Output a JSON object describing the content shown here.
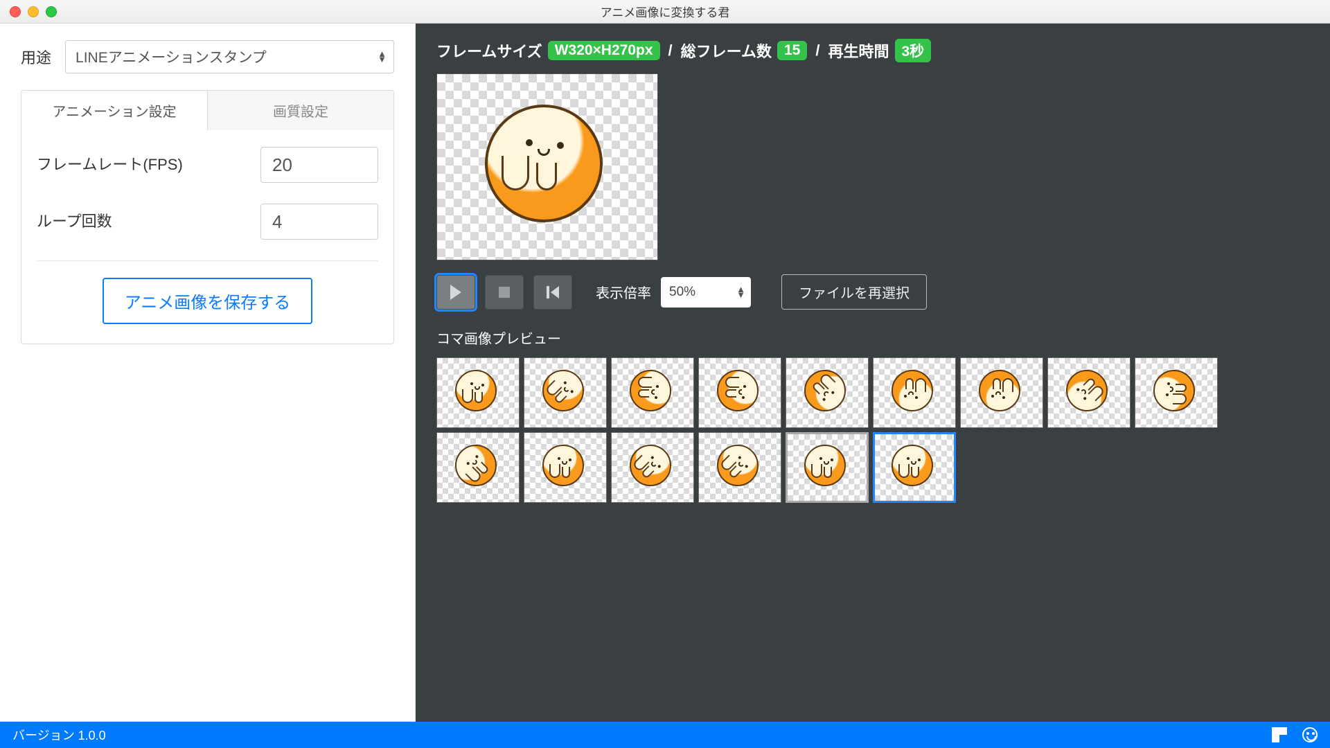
{
  "title": "アニメ画像に変換する君",
  "sidebar": {
    "purpose_label": "用途",
    "purpose_value": "LINEアニメーションスタンプ",
    "tabs": {
      "anim": "アニメーション設定",
      "quality": "画質設定"
    },
    "framerate_label": "フレームレート(FPS)",
    "framerate_value": "20",
    "loop_label": "ループ回数",
    "loop_value": "4",
    "save_btn": "アニメ画像を保存する"
  },
  "content": {
    "frame_size_label": "フレームサイズ",
    "frame_size_value": "W320×H270px",
    "total_frames_label": "総フレーム数",
    "total_frames_value": "15",
    "duration_label": "再生時間",
    "duration_value": "3秒",
    "zoom_label": "表示倍率",
    "zoom_value": "50%",
    "reselect_btn": "ファイルを再選択",
    "frames_title": "コマ画像プレビュー"
  },
  "footer": {
    "version": "バージョン 1.0.0"
  },
  "frames": [
    {
      "rot": "rot0"
    },
    {
      "rot": "rot45"
    },
    {
      "rot": "rot90"
    },
    {
      "rot": "rot90"
    },
    {
      "rot": "rot135"
    },
    {
      "rot": "rot180"
    },
    {
      "rot": "rot180"
    },
    {
      "rot": "rot225"
    },
    {
      "rot": "rot270"
    },
    {
      "rot": "rot315"
    },
    {
      "rot": "rot0"
    },
    {
      "rot": "rot45"
    },
    {
      "rot": "rot45"
    },
    {
      "rot": "rot0",
      "sel": "gray"
    },
    {
      "rot": "rot0",
      "sel": "blue"
    }
  ]
}
